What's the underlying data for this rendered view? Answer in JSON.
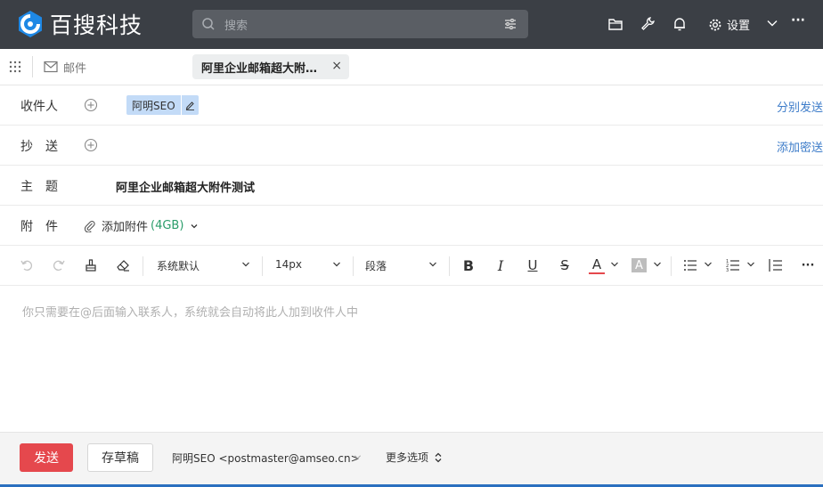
{
  "app": {
    "logo_text": "百搜科技"
  },
  "header": {
    "search_placeholder": "搜索",
    "settings_label": "设置",
    "more_label": "···"
  },
  "tabs": {
    "mail_label": "邮件",
    "active_label": "阿里企业邮箱超大附…",
    "close_label": "×"
  },
  "compose": {
    "to_label": "收件人",
    "recipient_chip": "阿明SEO",
    "send_separately": "分别发送",
    "cc_label": "抄　送",
    "add_bcc": "添加密送",
    "subject_label": "主　题",
    "subject_value": "阿里企业邮箱超大附件测试",
    "attach_label": "附　件",
    "add_attachment": "添加附件",
    "attach_size": "(4GB)"
  },
  "toolbar": {
    "font_family": "系统默认",
    "font_size": "14px",
    "paragraph": "段落",
    "bold": "B",
    "italic": "I",
    "underline": "U",
    "strike": "S",
    "font_color": "A",
    "bg_color": "A",
    "more": "···"
  },
  "editor": {
    "placeholder": "你只需要在@后面输入联系人，系统就会自动将此人加到收件人中"
  },
  "footer": {
    "send_label": "发送",
    "draft_label": "存草稿",
    "sender": "阿明SEO <postmaster@amseo.cn>",
    "more_options": "更多选项"
  },
  "colors": {
    "topbar": "#3b3f45",
    "accent_red": "#e5484d",
    "link_blue": "#3d7cc9",
    "chip_blue": "#c3dbf7",
    "size_green": "#2a9d6a"
  }
}
